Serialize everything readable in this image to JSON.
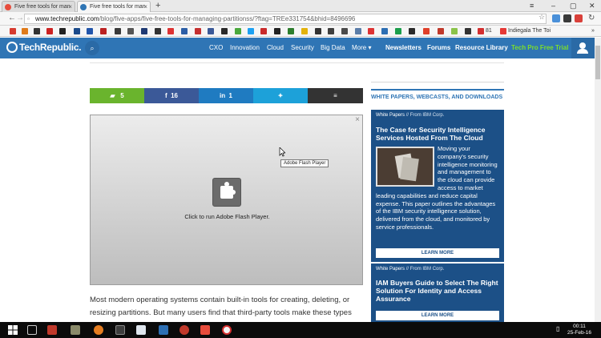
{
  "browser": {
    "tabs": [
      {
        "title": "Five free tools for man",
        "active": false
      },
      {
        "title": "Five free tools for man",
        "active": true
      }
    ],
    "new_tab": "+",
    "url_domain": "www.techrepublic.com",
    "url_path": "/blog/five-apps/five-free-tools-for-managing-partitionss/?ftag=TREe331754&bhid=8496696",
    "bookmarks_visible_text": [
      "81",
      "Indiegala The Toi"
    ],
    "overflow": "»"
  },
  "site": {
    "logo": "TechRepublic.",
    "nav": [
      "CXO",
      "Innovation",
      "Cloud",
      "Security",
      "Big Data",
      "More"
    ],
    "nav_right": [
      "Newsletters",
      "Forums",
      "Resource Library"
    ],
    "pro_trial": "Tech Pro Free Trial"
  },
  "share": {
    "comments": "5",
    "facebook": "16",
    "linkedin": "1",
    "twitter": "",
    "more": ""
  },
  "flash": {
    "message": "Click to run Adobe Flash Player.",
    "tooltip": "Adobe Flash Player",
    "close": "×"
  },
  "article": {
    "text": "Most modern operating systems contain built-in tools for creating, deleting, or resizing partitions. But many users find that third-party tools make these types"
  },
  "sidebar": {
    "heading": "WHITE PAPERS, WEBCASTS, AND DOWNLOADS",
    "cards": [
      {
        "type": "White Papers",
        "sep": "//",
        "from": "From IBM Corp.",
        "title": "The Case for Security Intelligence Services Hosted From The Cloud",
        "description": "Moving your company's security intelligence monitoring and management to the cloud can provide access to market leading capabilities and reduce capital expense. This paper outlines the advantages of the IBM security intelligence solution, delivered from the cloud, and monitored by service professionals.",
        "button": "LEARN MORE"
      },
      {
        "type": "White Papers",
        "sep": "//",
        "from": "From IBM Corp.",
        "title": "IAM Buyers Guide to Select The Right Solution For Identity and Access Assurance",
        "button": "LEARN MORE"
      }
    ]
  },
  "taskbar": {
    "time": "00:11",
    "date": "25-Feb-16"
  },
  "colors": {
    "brand_blue": "#2f75b5",
    "card_blue": "#1c5087",
    "comment_green": "#6ab42d",
    "facebook": "#3b5998",
    "linkedin": "#1f7bc1",
    "twitter": "#1da1d9",
    "more": "#333333",
    "pro_green": "#7dde2b"
  },
  "icons": [
    "search-icon",
    "comment-icon",
    "facebook-icon",
    "linkedin-icon",
    "twitter-icon",
    "menu-icon",
    "puzzle-icon",
    "user-icon",
    "star-icon",
    "back-icon",
    "forward-icon",
    "reload-icon"
  ]
}
